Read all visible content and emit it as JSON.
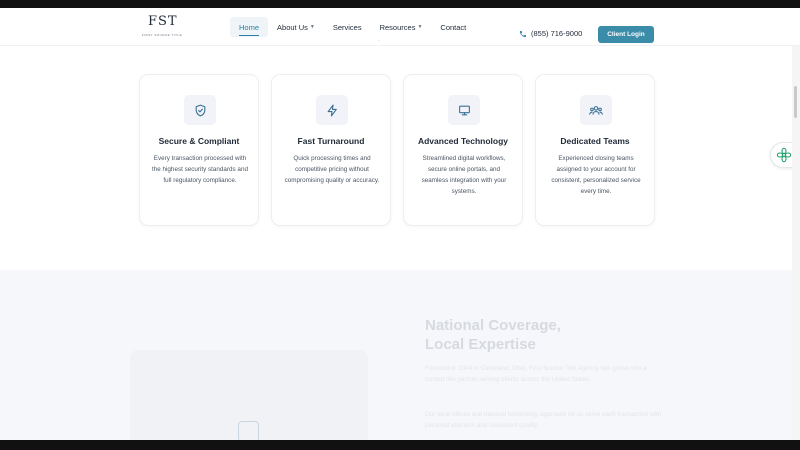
{
  "logo": {
    "mark": "FST",
    "tagline": "FIRST SOURCE TITLE"
  },
  "nav": {
    "items": [
      {
        "label": "Home",
        "active": true,
        "dropdown": false
      },
      {
        "label": "About Us",
        "active": false,
        "dropdown": true
      },
      {
        "label": "Services",
        "active": false,
        "dropdown": false
      },
      {
        "label": "Resources",
        "active": false,
        "dropdown": true
      },
      {
        "label": "Contact",
        "active": false,
        "dropdown": false
      }
    ],
    "phone": "(855) 716-9000",
    "login_label": "Client Login"
  },
  "features": [
    {
      "icon": "shield-check-icon",
      "title": "Secure & Compliant",
      "desc": "Every transaction processed with the highest security standards and full regulatory compliance."
    },
    {
      "icon": "lightning-icon",
      "title": "Fast Turnaround",
      "desc": "Quick processing times and competitive pricing without compromising quality or accuracy."
    },
    {
      "icon": "monitor-icon",
      "title": "Advanced Technology",
      "desc": "Streamlined digital workflows, secure online portals, and seamless integration with your systems."
    },
    {
      "icon": "team-icon",
      "title": "Dedicated Teams",
      "desc": "Experienced closing teams assigned to your account for consistent, personalized service every time."
    }
  ],
  "coverage": {
    "title_line1": "National Coverage,",
    "title_line2": "Local Expertise",
    "p1": "Founded in 2004 in Cleveland, Ohio, First Source Title Agency has grown into a trusted title partner serving clients across the United States.",
    "p2": "Our local offices and national technology approach let us serve each transaction with personal attention and consistent quality."
  },
  "colors": {
    "accent": "#2a7ea8",
    "button": "#3a8ca9",
    "icon": "#3b6f94",
    "fab": "#22a06b"
  }
}
